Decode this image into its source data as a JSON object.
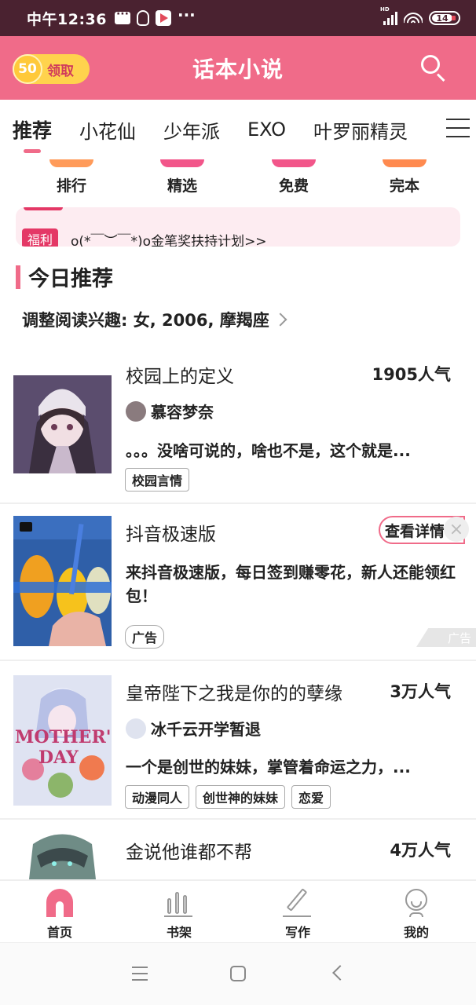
{
  "status_bar": {
    "time": "中午12:36",
    "network": "HD",
    "battery": "14"
  },
  "header": {
    "coin_value": "50",
    "coin_label": "领取",
    "title": "话本小说"
  },
  "tabs": [
    "推荐",
    "小花仙",
    "少年派",
    "EXO",
    "叶罗丽精灵"
  ],
  "quick_nav": [
    {
      "label": "排行",
      "color": "#ff9b5a"
    },
    {
      "label": "精选",
      "color": "#f2568a"
    },
    {
      "label": "免费",
      "color": "#f2568a"
    },
    {
      "label": "完本",
      "color": "#ff8a4f"
    }
  ],
  "notice": {
    "tag": "福利",
    "text": "o(*￣︶￣*)o金笔奖扶持计划>>"
  },
  "section": {
    "title": "今日推荐",
    "interest": "调整阅读兴趣: 女, 2006, 摩羯座"
  },
  "books": [
    {
      "title": "校园上的定义",
      "popularity": "1905人气",
      "author": "慕容梦奈",
      "description": "。。。没啥可说的，啥也不是，这个就是...",
      "tags": [
        "校园言情"
      ]
    },
    {
      "title": "皇帝陛下之我是你的的孽缘",
      "popularity": "3万人气",
      "author": "冰千云开学暂退",
      "description": "一个是创世的妹妹，掌管着命运之力，...",
      "tags": [
        "动漫同人",
        "创世神的妹妹",
        "恋爱"
      ]
    },
    {
      "title": "金说他谁都不帮",
      "popularity": "4万人气"
    }
  ],
  "ad": {
    "title": "抖音极速版",
    "detail_button": "查看详情",
    "description": "来抖音极速版，每日签到赚零花，新人还能领红包！",
    "tag": "广告",
    "ad_flag": "广告"
  },
  "bottom_nav": [
    "首页",
    "书架",
    "写作",
    "我的"
  ],
  "colors": {
    "brand": "#f06b89",
    "status_bar": "#4a2230",
    "notice_tag": "#e43866"
  }
}
